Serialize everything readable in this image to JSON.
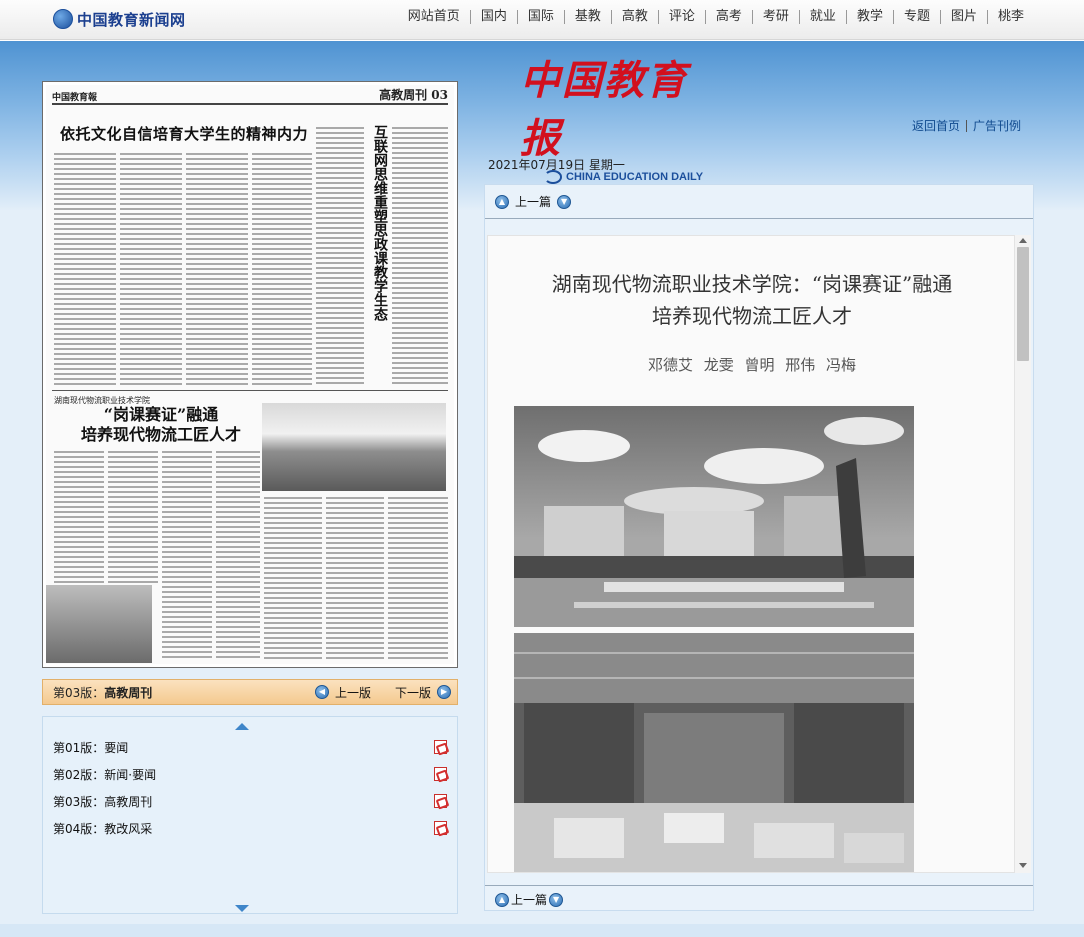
{
  "site": {
    "logo_text": "中国教育新闻网"
  },
  "nav": [
    "网站首页",
    "国内",
    "国际",
    "基教",
    "高教",
    "评论",
    "高考",
    "考研",
    "就业",
    "教学",
    "专题",
    "图片",
    "桃李"
  ],
  "masthead": {
    "title": "中国教育报",
    "english": "CHINA EDUCATION DAILY"
  },
  "right_links": [
    "返回首页",
    "广告刊例"
  ],
  "issue_date": "2021年07月19日  星期一",
  "newspaper_page": {
    "mast_left": "中国教育報",
    "mast_right": "高教周刊 03",
    "headline": "依托文化自信培育大学生的精神内力",
    "vertical_headline": "互联网思维重塑思政课教学生态",
    "sub_kicker": "湖南现代物流职业技术学院",
    "sub_headline_1": "“岗课赛证”融通",
    "sub_headline_2": "培养现代物流工匠人才"
  },
  "page_label": {
    "prefix": "第03版：",
    "name": "高教周刊",
    "prev": "上一版",
    "next": "下一版"
  },
  "editions": [
    "第01版：要闻",
    "第02版：新闻·要闻",
    "第03版：高教周刊",
    "第04版：教改风采"
  ],
  "article": {
    "prev_label": "上一篇",
    "title_line1": "湖南现代物流职业技术学院：“岗课赛证”融通",
    "title_line2": "培养现代物流工匠人才",
    "authors": "邓德艾  龙雯  曾明  邢伟  冯梅"
  },
  "colors": {
    "nav_blue": "#4f93d2",
    "masthead_red": "#d2101e",
    "link_blue": "#114b8f",
    "label_orange": "#f4c98f"
  },
  "icons": [
    "globe-logo-icon",
    "prev-circle-icon",
    "next-circle-icon",
    "pdf-icon",
    "scroll-up-icon",
    "scroll-down-icon"
  ]
}
